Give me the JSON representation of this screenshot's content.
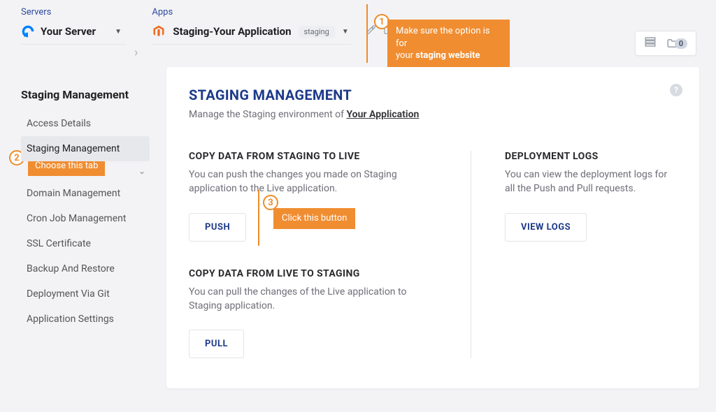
{
  "breadcrumb": {
    "servers_label": "Servers",
    "server_name": "Your Server",
    "apps_label": "Apps",
    "app_name": "Staging-Your Application",
    "app_badge": "staging"
  },
  "callouts": {
    "c1_num": "1",
    "c1_line1": "Make sure the option is for",
    "c1_line2_a": "your ",
    "c1_line2_b": "staging website",
    "c2_num": "2",
    "c2_text": "Choose this tab",
    "c3_num": "3",
    "c3_text": "Click this button"
  },
  "top_widgets": {
    "count": "0"
  },
  "sidebar": {
    "title": "Staging Management",
    "items": [
      {
        "label": "Access Details"
      },
      {
        "label": "Staging Management"
      },
      {
        "label": "Domain Management"
      },
      {
        "label": "Cron Job Management"
      },
      {
        "label": "SSL Certificate"
      },
      {
        "label": "Backup And Restore"
      },
      {
        "label": "Deployment Via Git"
      },
      {
        "label": "Application Settings"
      }
    ]
  },
  "page": {
    "title": "STAGING MANAGEMENT",
    "sub_prefix": "Manage the Staging environment of ",
    "sub_link": "Your Application"
  },
  "left": {
    "s2l_h": "COPY DATA FROM STAGING TO LIVE",
    "s2l_p": "You can push the changes you made on Staging application to the Live application.",
    "push": "PUSH",
    "l2s_h": "COPY DATA FROM LIVE TO STAGING",
    "l2s_p": "You can pull the changes of the Live application to Staging application.",
    "pull": "PULL"
  },
  "right": {
    "log_h": "DEPLOYMENT LOGS",
    "log_p": "You can view the deployment logs for all the Push and Pull requests.",
    "view": "VIEW LOGS"
  }
}
